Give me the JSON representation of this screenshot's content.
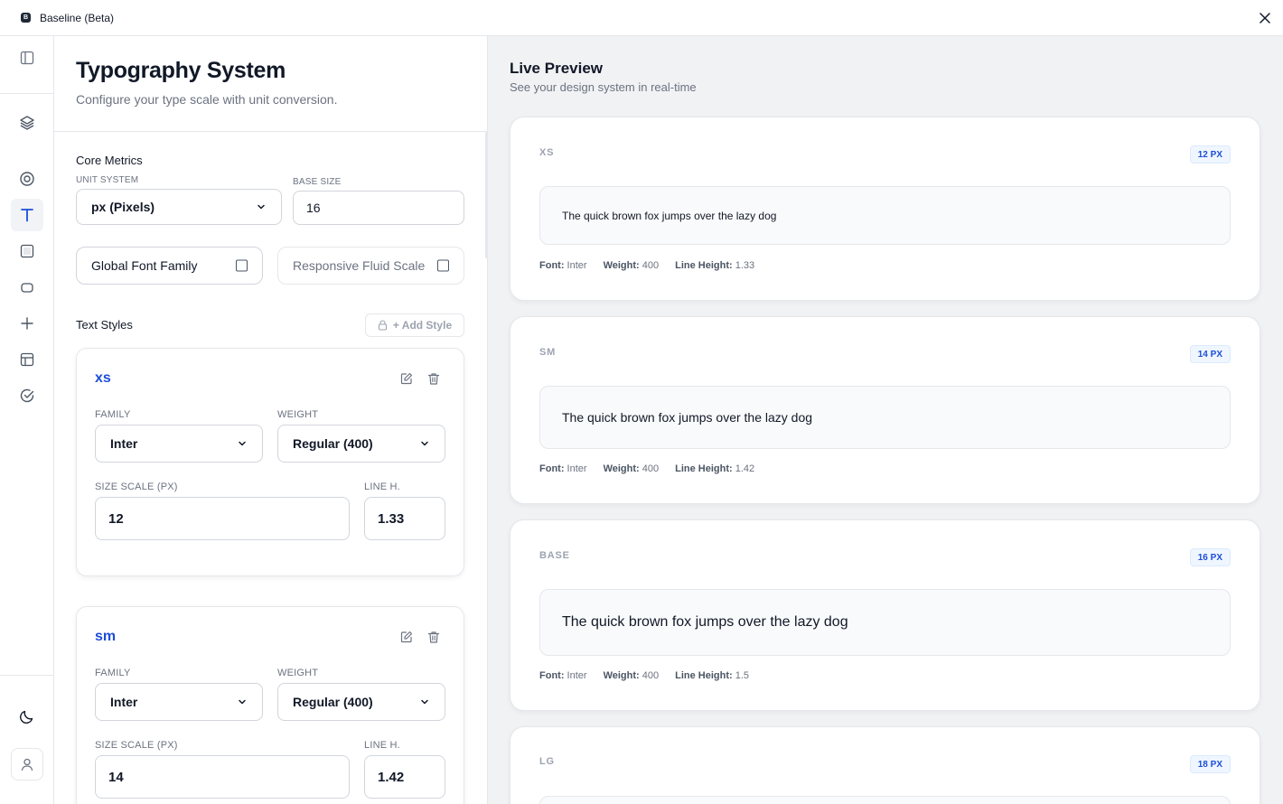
{
  "app": {
    "logo_letter": "B",
    "title": "Baseline (Beta)"
  },
  "rail": {
    "items": [
      {
        "name": "sidebar-toggle-icon"
      },
      {
        "name": "layers-icon"
      },
      {
        "name": "target-icon"
      },
      {
        "name": "typography-icon",
        "active": true
      },
      {
        "name": "square-icon"
      },
      {
        "name": "rounded-rect-icon"
      },
      {
        "name": "plus-icon"
      },
      {
        "name": "layout-icon"
      },
      {
        "name": "check-circle-icon"
      },
      {
        "name": "moon-icon"
      },
      {
        "name": "user-icon"
      }
    ]
  },
  "config": {
    "title": "Typography System",
    "subtitle": "Configure your type scale with unit conversion.",
    "core_metrics_label": "Core Metrics",
    "unit_system_label": "UNIT SYSTEM",
    "unit_system_value": "px (Pixels)",
    "base_size_label": "BASE SIZE",
    "base_size_value": "16",
    "global_font_label": "Global Font Family",
    "fluid_scale_label": "Responsive Fluid Scale",
    "text_styles_label": "Text Styles",
    "add_style_label": "+ Add Style",
    "styles": [
      {
        "name": "xs",
        "family_label": "FAMILY",
        "family": "Inter",
        "weight_label": "WEIGHT",
        "weight": "Regular (400)",
        "size_label": "SIZE SCALE (PX)",
        "size": "12",
        "lh_label": "LINE H.",
        "line_height": "1.33"
      },
      {
        "name": "sm",
        "family_label": "FAMILY",
        "family": "Inter",
        "weight_label": "WEIGHT",
        "weight": "Regular (400)",
        "size_label": "SIZE SCALE (PX)",
        "size": "14",
        "lh_label": "LINE H.",
        "line_height": "1.42"
      }
    ]
  },
  "preview": {
    "title": "Live Preview",
    "subtitle": "See your design system in real-time",
    "sample_text": "The quick brown fox jumps over the lazy dog",
    "font_label": "Font:",
    "weight_label": "Weight:",
    "lh_label": "Line Height:",
    "cards": [
      {
        "token": "XS",
        "badge": "12 PX",
        "font": "Inter",
        "weight": "400",
        "line_height": "1.33"
      },
      {
        "token": "SM",
        "badge": "14 PX",
        "font": "Inter",
        "weight": "400",
        "line_height": "1.42"
      },
      {
        "token": "BASE",
        "badge": "16 PX",
        "font": "Inter",
        "weight": "400",
        "line_height": "1.5"
      },
      {
        "token": "LG",
        "badge": "18 PX"
      }
    ]
  },
  "colors": {
    "accent": "#1d4ed8",
    "border": "#e5e7eb",
    "preview_bg": "#f1f2f4"
  }
}
